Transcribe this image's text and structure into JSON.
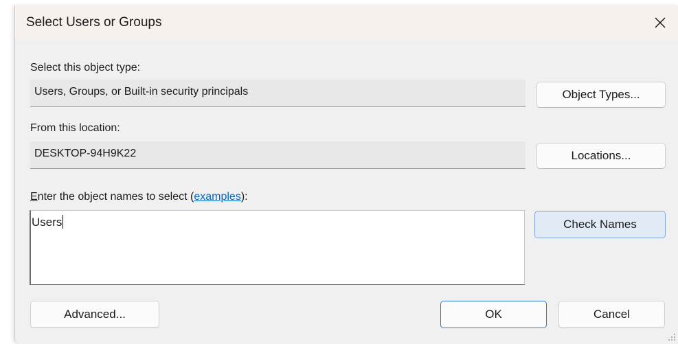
{
  "dialog": {
    "title": "Select Users or Groups",
    "close_icon": "close-icon"
  },
  "object_type": {
    "label": "Select this object type:",
    "value": "Users, Groups, or Built-in security principals",
    "button": "Object Types..."
  },
  "location": {
    "label": "From this location:",
    "value": "DESKTOP-94H9K22",
    "button": "Locations..."
  },
  "names": {
    "label_accel": "E",
    "label_pre": "nter the object names to select (",
    "label_link": "examples",
    "label_post": "):",
    "value": "Users",
    "check_button": "Check Names"
  },
  "footer": {
    "advanced_button": "Advanced...",
    "ok_button": "OK",
    "cancel_button": "Cancel"
  },
  "colors": {
    "titlebar": "#f7f1ee",
    "dialog_bg": "#f0f0f0",
    "link": "#0066cc",
    "focus_border": "#2f78c6"
  }
}
